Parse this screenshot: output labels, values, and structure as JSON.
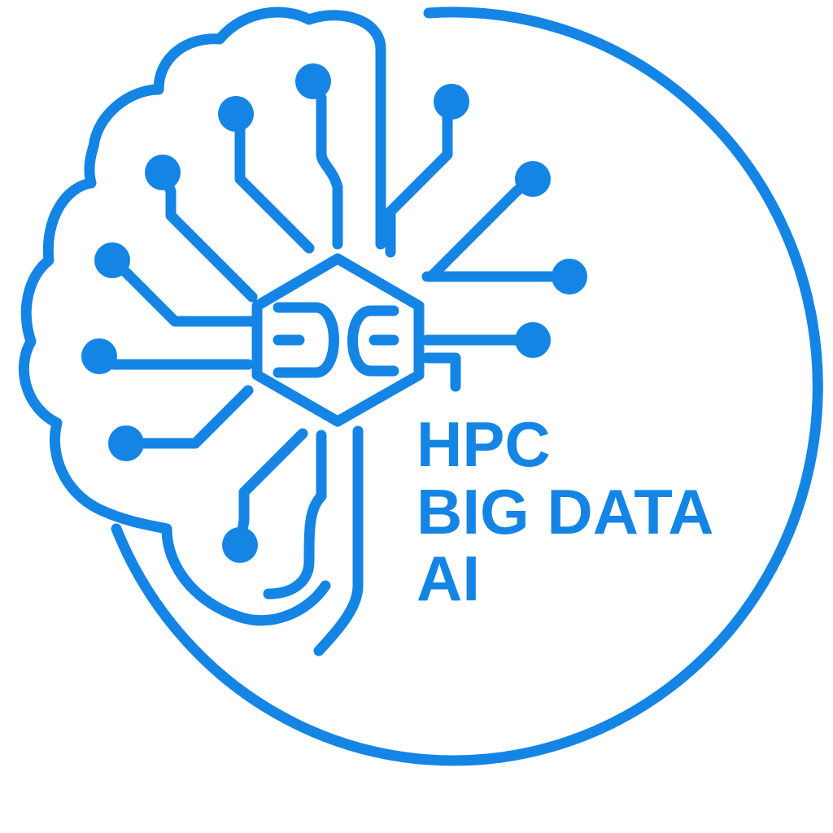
{
  "logo": {
    "lines": [
      "HPC",
      "BIG DATA",
      "AI"
    ],
    "monogram": "DC",
    "colors": {
      "primary": "#1485E4",
      "background": "#FFFFFF"
    }
  }
}
